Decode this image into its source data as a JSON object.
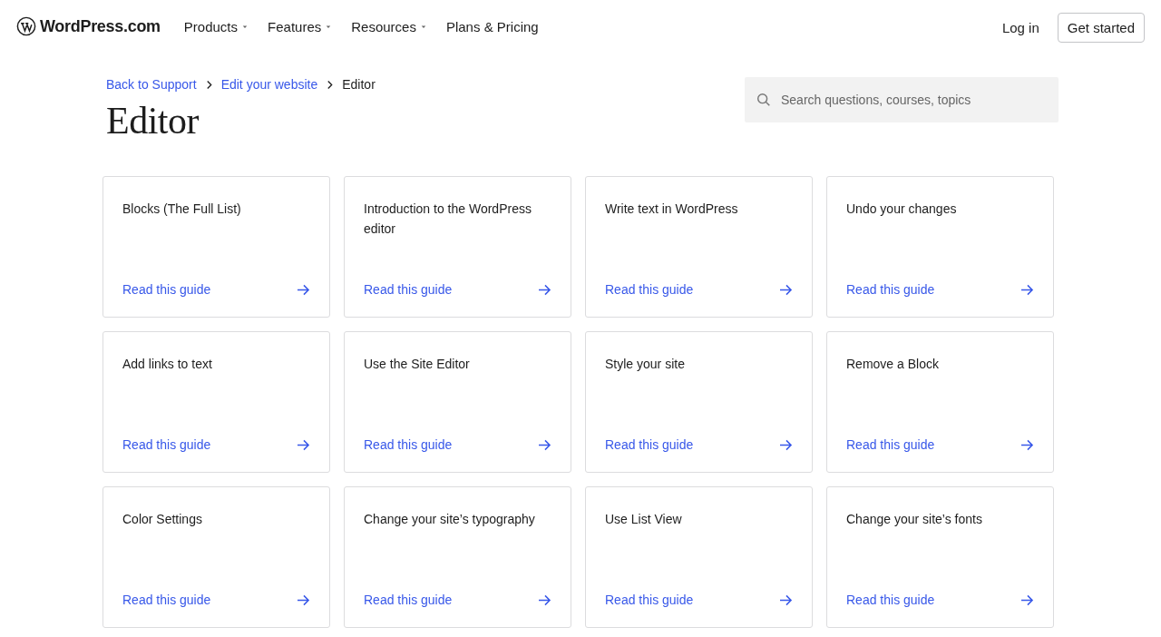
{
  "header": {
    "logo": "WordPress.com",
    "nav": [
      {
        "label": "Products",
        "has_menu": true
      },
      {
        "label": "Features",
        "has_menu": true
      },
      {
        "label": "Resources",
        "has_menu": true
      },
      {
        "label": "Plans & Pricing",
        "has_menu": false
      }
    ],
    "login": "Log in",
    "cta": "Get started"
  },
  "breadcrumb": [
    "Back to Support",
    "Edit your website",
    "Editor"
  ],
  "title": "Editor",
  "search": {
    "placeholder": "Search questions, courses, topics"
  },
  "cards": [
    {
      "title": "Blocks (The Full List)",
      "link": "Read this guide"
    },
    {
      "title": "Introduction to the WordPress editor",
      "link": "Read this guide"
    },
    {
      "title": "Write text in WordPress",
      "link": "Read this guide"
    },
    {
      "title": "Undo your changes",
      "link": "Read this guide"
    },
    {
      "title": "Add links to text",
      "link": "Read this guide"
    },
    {
      "title": "Use the Site Editor",
      "link": "Read this guide"
    },
    {
      "title": "Style your site",
      "link": "Read this guide"
    },
    {
      "title": "Remove a Block",
      "link": "Read this guide"
    },
    {
      "title": "Color Settings",
      "link": "Read this guide"
    },
    {
      "title": "Change your site’s typography",
      "link": "Read this guide"
    },
    {
      "title": "Use List View",
      "link": "Read this guide"
    },
    {
      "title": "Change your site’s fonts",
      "link": "Read this guide"
    }
  ]
}
